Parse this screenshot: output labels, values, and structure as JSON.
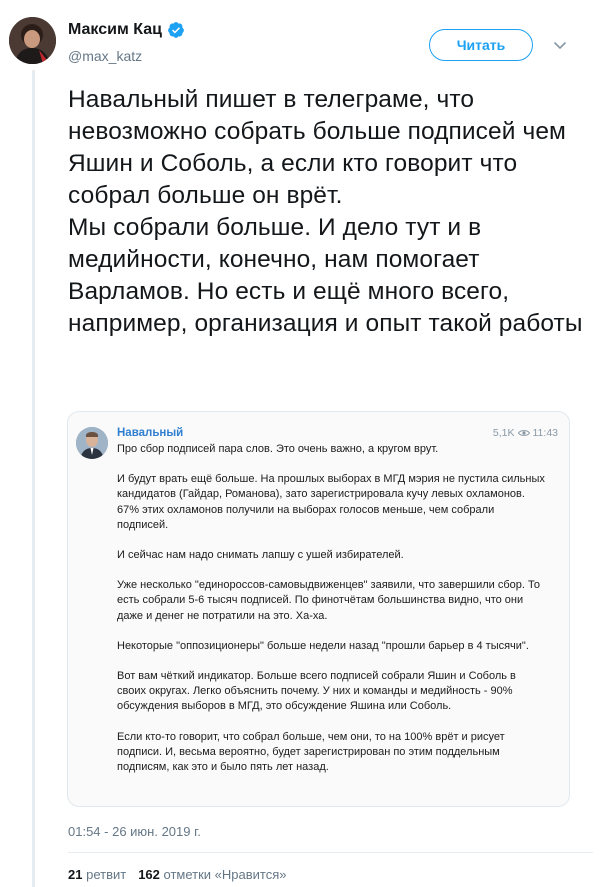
{
  "author": {
    "name": "Максим Кац",
    "handle": "@max_katz",
    "verified": true
  },
  "follow_button": {
    "label": "Читать"
  },
  "tweet": {
    "paragraphs": [
      "Навальный пишет в телеграме, что невозможно собрать больше подписей чем Яшин и Соболь, а если кто говорит что собрал больше он врёт.",
      "Мы собрали больше. И дело тут и в медийности, конечно, нам помогает Варламов. Но есть и ещё много всего, например, организация и опыт такой работы"
    ]
  },
  "telegram_post": {
    "channel": "Навальный",
    "views": "5,1K",
    "time": "11:43",
    "paragraphs": [
      "Про сбор подписей пара слов. Это очень важно, а кругом врут.",
      "И будут врать ещё больше. На прошлых выборах в МГД мэрия не пустила сильных кандидатов (Гайдар, Романова), зато зарегистрировала кучу левых охламонов. 67% этих охламонов получили на выборах голосов меньше, чем собрали подписей.",
      "И сейчас нам надо снимать лапшу с ушей избирателей.",
      "Уже несколько \"единороссов-самовыдвиженцев\" заявили, что завершили сбор. То есть собрали 5-6 тысяч подписей. По финотчётам большинства видно, что они даже и денег не потратили на это. Ха-ха.",
      "Некоторые \"оппозиционеры\" больше недели назад \"прошли барьер в 4 тысячи\".",
      "Вот вам чёткий индикатор. Больше всего подписей собрали Яшин и Соболь в своих округах. Легко объяснить почему. У них и команды и медийность - 90% обсуждения выборов в МГД, это обсуждение Яшина или Соболь.",
      "Если кто-то говорит, что собрал больше, чем они, то на 100% врёт и рисует подписи. И, весьма вероятно, будет зарегистрирован по этим поддельным подписям, как это и было пять лет назад."
    ]
  },
  "timestamp": "01:54 - 26 июн. 2019 г.",
  "stats": {
    "retweets_count": "21",
    "retweets_label": "ретвит",
    "likes_count": "162",
    "likes_label": "отметки «Нравится»"
  },
  "colors": {
    "accent": "#1da1f2",
    "text": "#14171a",
    "muted": "#657786",
    "telegram_link": "#2f7fd0"
  }
}
